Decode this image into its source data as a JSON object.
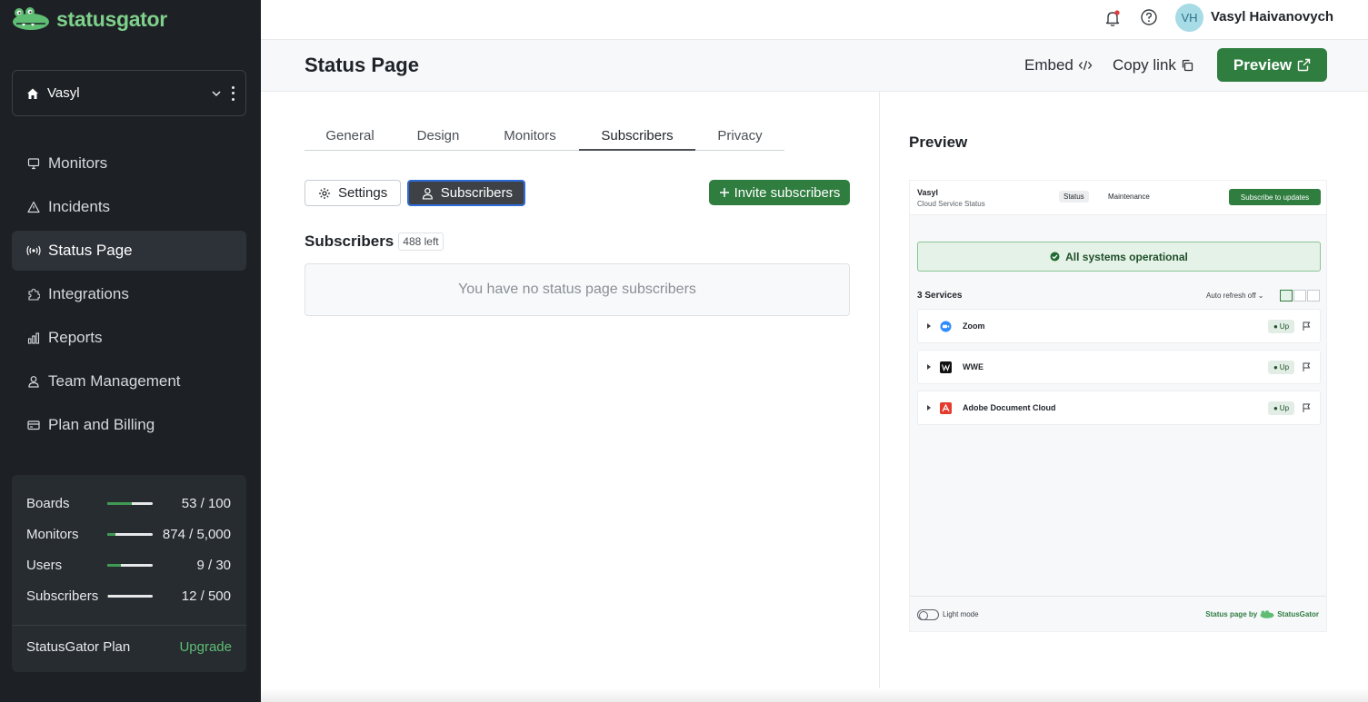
{
  "sidebar": {
    "logo_text": "statusgator",
    "org": {
      "name": "Vasyl"
    },
    "nav": [
      {
        "label": "Monitors",
        "icon": "monitor-icon",
        "active": false
      },
      {
        "label": "Incidents",
        "icon": "warning-icon",
        "active": false
      },
      {
        "label": "Status Page",
        "icon": "broadcast-icon",
        "active": true
      },
      {
        "label": "Integrations",
        "icon": "puzzle-icon",
        "active": false
      },
      {
        "label": "Reports",
        "icon": "bar-chart-icon",
        "active": false
      },
      {
        "label": "Team Management",
        "icon": "user-icon",
        "active": false
      },
      {
        "label": "Plan and Billing",
        "icon": "credit-card-icon",
        "active": false
      }
    ],
    "usage": [
      {
        "label": "Boards",
        "value": "53 / 100",
        "fraction": 0.53
      },
      {
        "label": "Monitors",
        "value": "874 / 5,000",
        "fraction": 0.175
      },
      {
        "label": "Users",
        "value": "9 / 30",
        "fraction": 0.3
      },
      {
        "label": "Subscribers",
        "value": "12 / 500",
        "fraction": 0.024
      }
    ],
    "plan": {
      "name": "StatusGator Plan",
      "upgrade": "Upgrade"
    }
  },
  "topbar": {
    "avatar_initials": "VH",
    "user_name": "Vasyl Haivanovych"
  },
  "header": {
    "title": "Status Page",
    "embed": "Embed",
    "copy_link": "Copy link",
    "preview": "Preview"
  },
  "tabs": [
    {
      "label": "General",
      "active": false
    },
    {
      "label": "Design",
      "active": false
    },
    {
      "label": "Monitors",
      "active": false
    },
    {
      "label": "Subscribers",
      "active": true
    },
    {
      "label": "Privacy",
      "active": false
    }
  ],
  "subtabs": {
    "settings": "Settings",
    "subscribers": "Subscribers"
  },
  "invite_button": "Invite subscribers",
  "subscribers": {
    "title": "Subscribers",
    "left_badge": "488 left",
    "empty_message": "You have no status page subscribers"
  },
  "preview_panel": {
    "title": "Preview",
    "org": "Vasyl",
    "subtitle": "Cloud Service Status",
    "tab_status": "Status",
    "tab_maintenance": "Maintenance",
    "subscribe": "Subscribe to updates",
    "status_banner": "All systems operational",
    "services_header": "3 Services",
    "auto_refresh": "Auto refresh off",
    "services": [
      {
        "name": "Zoom",
        "status": "Up",
        "logo_color": "#2d8cff"
      },
      {
        "name": "WWE",
        "status": "Up",
        "logo_color": "#111111"
      },
      {
        "name": "Adobe Document Cloud",
        "status": "Up",
        "logo_color": "#e33b2e"
      }
    ],
    "light_mode": "Light mode",
    "powered_by": "Status page by",
    "brand": "StatusGator"
  },
  "colors": {
    "sidebar_bg": "#1d2125",
    "accent_green": "#2f7d3f",
    "active_outline": "#2f6bd7"
  }
}
